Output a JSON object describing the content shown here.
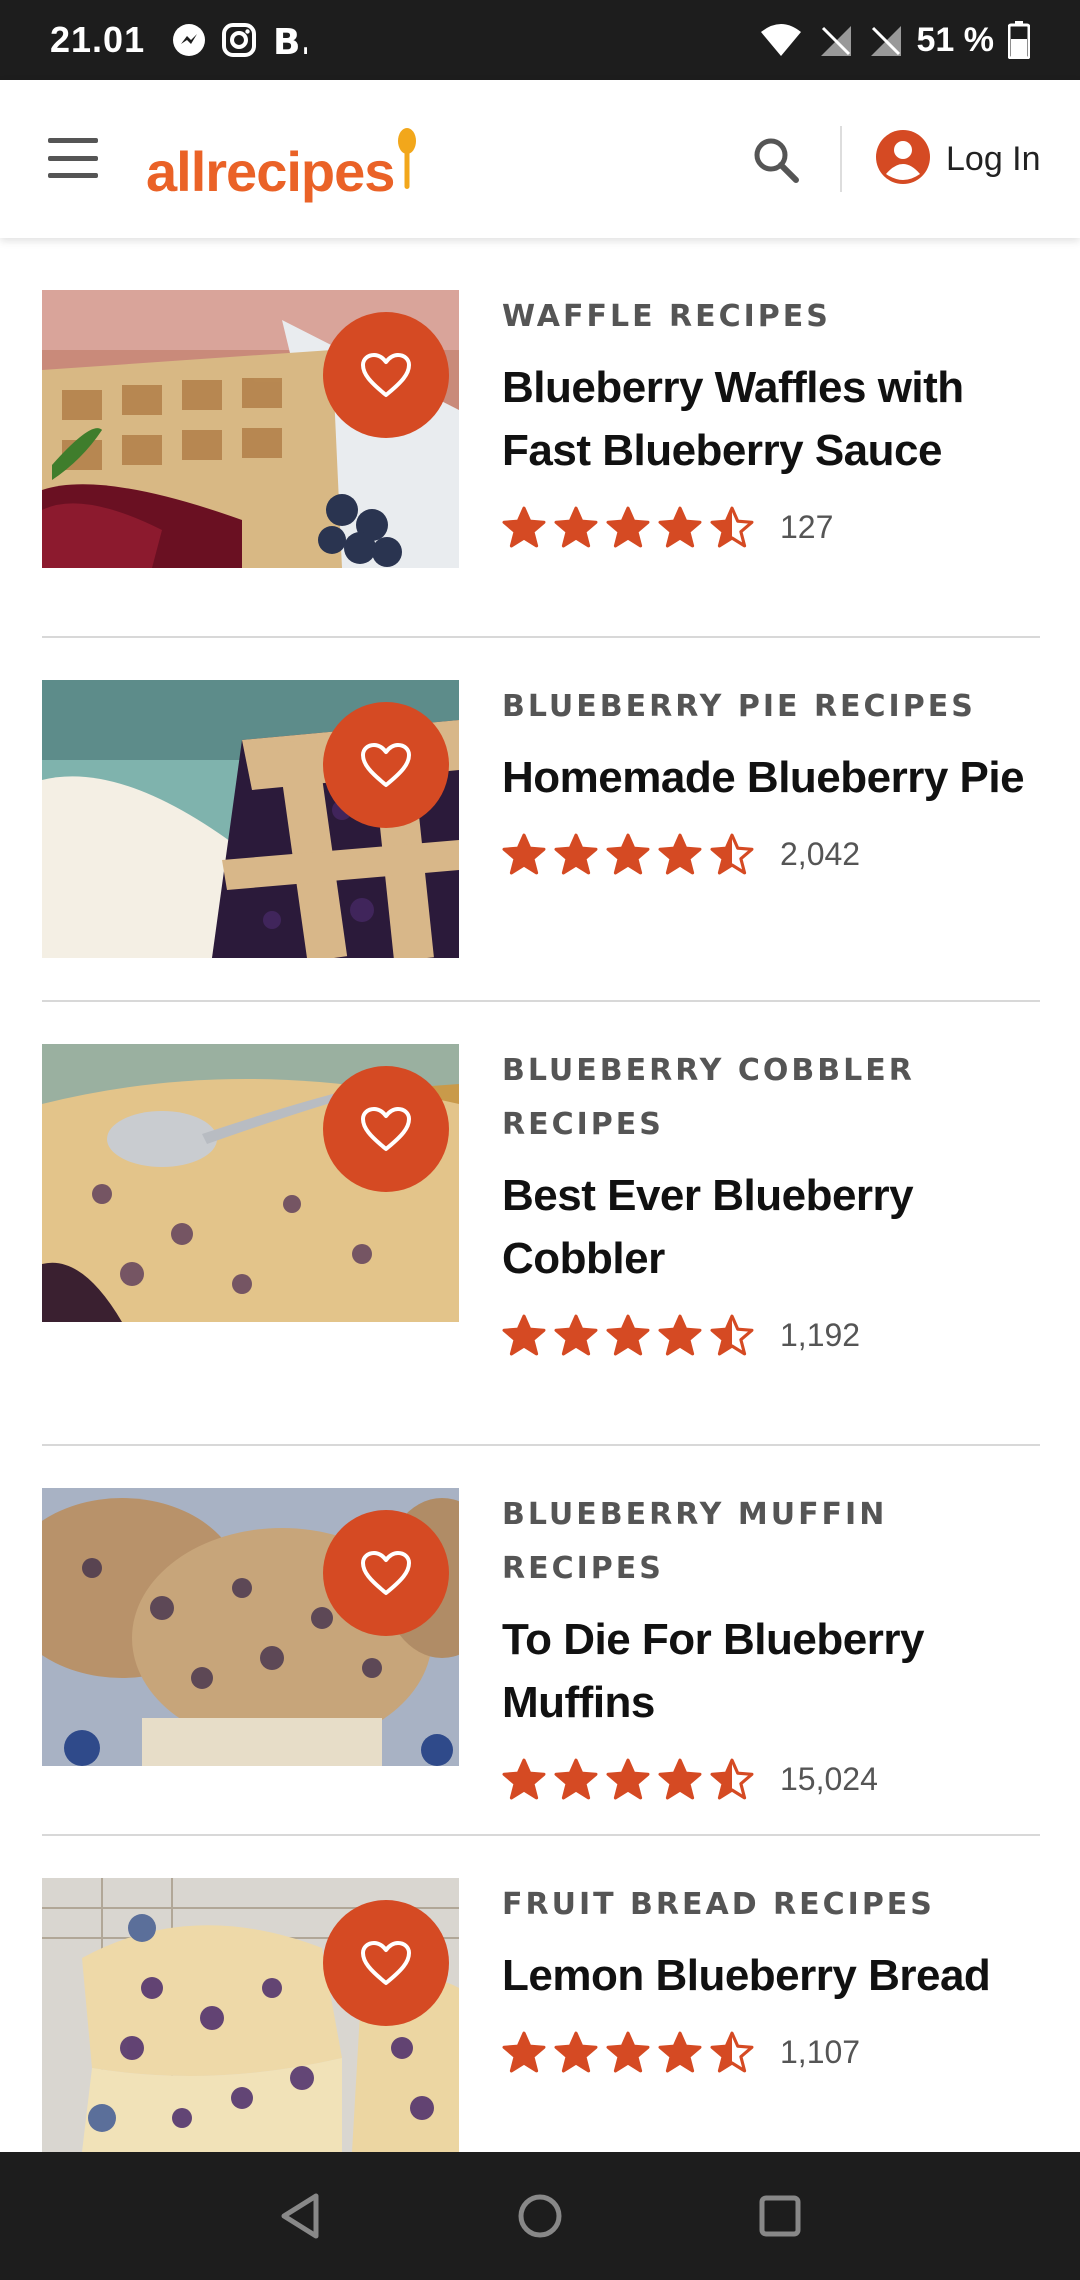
{
  "status_bar": {
    "time": "21.01",
    "battery_text": "51 %",
    "icons": [
      "messenger-icon",
      "instagram-icon",
      "b-app-icon",
      "wifi-icon",
      "no-signal-icon",
      "no-signal-icon",
      "battery-icon"
    ]
  },
  "header": {
    "logo_text": "allrecipes",
    "login_label": "Log In",
    "accent_color": "#ea6227"
  },
  "recipes": [
    {
      "category": "WAFFLE RECIPES",
      "title": "Blueberry Waffles with Fast Blueberry Sauce",
      "rating": 4.5,
      "rating_count": "127",
      "image": "blueberry waffles"
    },
    {
      "category": "BLUEBERRY PIE RECIPES",
      "title": "Homemade Blueberry Pie",
      "rating": 4.5,
      "rating_count": "2,042",
      "image": "blueberry pie"
    },
    {
      "category": "BLUEBERRY COBBLER RECIPES",
      "title": "Best Ever Blueberry Cobbler",
      "rating": 4.5,
      "rating_count": "1,192",
      "image": "blueberry cobbler"
    },
    {
      "category": "BLUEBERRY MUFFIN RECIPES",
      "title": "To Die For Blueberry Muffins",
      "rating": 4.5,
      "rating_count": "15,024",
      "image": "blueberry muffins"
    },
    {
      "category": "FRUIT BREAD RECIPES",
      "title": "Lemon Blueberry Bread",
      "rating": 4.5,
      "rating_count": "1,107",
      "image": "lemon blueberry bread"
    }
  ],
  "colors": {
    "save_button": "#d54a23",
    "star": "#d54a23"
  },
  "nav_bar": {
    "buttons": [
      "back-icon",
      "home-icon",
      "recents-icon"
    ]
  }
}
